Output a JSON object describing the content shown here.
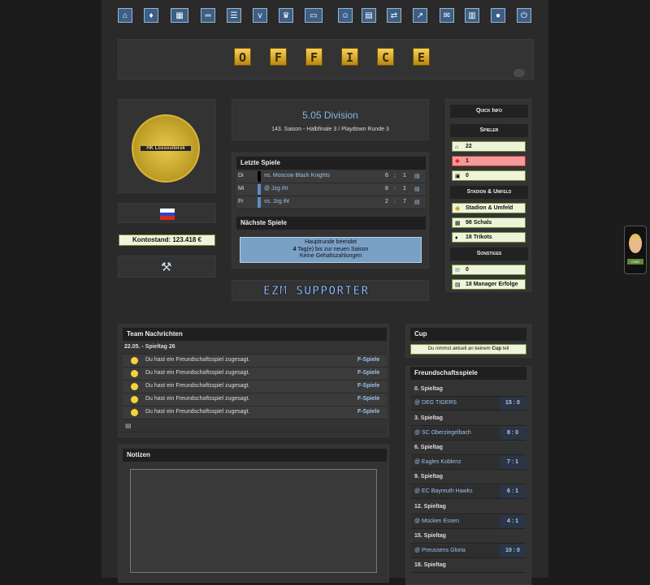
{
  "nav": {
    "icons": [
      "home-icon",
      "jersey-icon",
      "lineup-icon",
      "training-icon",
      "list-icon",
      "versus-icon",
      "trophy-icon",
      "tv-icon",
      "manager-icon",
      "calendar-icon",
      "transfer-icon",
      "stats-icon",
      "mail-icon",
      "table-icon",
      "chat-icon",
      "power-icon"
    ]
  },
  "banner": {
    "letters": [
      "O",
      "F",
      "F",
      "I",
      "C",
      "E"
    ]
  },
  "team": {
    "logo_text": "HK Lossosibirsk",
    "kontostand": "Kontostand: 123.418 €"
  },
  "division": {
    "name": "5.05 Division",
    "season": "143. Saison - Halbfinale 3 / Playdown Runde 3"
  },
  "last_games": {
    "header": "Letzte Spiele",
    "rows": [
      {
        "day": "Di",
        "opponent": "vs. Moscow Black Knights",
        "g1": "6",
        "sep": ":",
        "g2": "1"
      },
      {
        "day": "Mi",
        "opponent": "@ Jzg iht",
        "g1": "8",
        "sep": ":",
        "g2": "1"
      },
      {
        "day": "Fr",
        "opponent": "vs. Jzg iht",
        "g1": "2",
        "sep": ":",
        "g2": "7"
      }
    ]
  },
  "next_games": {
    "header": "Nächste Spiele",
    "line1": "Hauptrunde beendet",
    "line2_bold": "4",
    "line2_rest": " Tag(e) bis zur neuen Saison",
    "line3": "Keine Gehaltszahlungen"
  },
  "supporter": {
    "text": "EZM SUPPORTER"
  },
  "quick_info": {
    "title": "Quick Info",
    "spieler_header": "Spieler",
    "spieler": [
      {
        "icon": "house-icon",
        "value": "22"
      },
      {
        "icon": "medical-cross-icon",
        "value": "1"
      },
      {
        "icon": "id-card-icon",
        "value": "0"
      }
    ],
    "stadion_header": "Stadion & Umfeld",
    "stadion": [
      {
        "icon": "stadium-icon",
        "value": "Stadion & Umfeld"
      },
      {
        "icon": "scarf-icon",
        "value": "98 Schals"
      },
      {
        "icon": "jersey-icon",
        "value": "18 Trikots"
      }
    ],
    "sonstiges_header": "Sonstiges",
    "sonstiges": [
      {
        "icon": "envelope-icon",
        "value": "0"
      },
      {
        "icon": "achievement-icon",
        "value": "18 Manager Erfolge"
      }
    ]
  },
  "news": {
    "header": "Team Nachrichten",
    "date_row": "22.05. - Spieltag 26",
    "items": [
      {
        "text": "Du hast ein Freundschaftsspiel zugesagt.",
        "link": "F-Spiele"
      },
      {
        "text": "Du hast ein Freundschaftsspiel zugesagt.",
        "link": "F-Spiele"
      },
      {
        "text": "Du hast ein Freundschaftsspiel zugesagt.",
        "link": "F-Spiele"
      },
      {
        "text": "Du hast ein Freundschaftsspiel zugesagt.",
        "link": "F-Spiele"
      },
      {
        "text": "Du hast ein Freundschaftsspiel zugesagt.",
        "link": "F-Spiele"
      }
    ]
  },
  "notes": {
    "header": "Notizen"
  },
  "cup": {
    "header": "Cup",
    "text_pre": "Du nimmst aktuell an keinem ",
    "text_bold": "Cup",
    "text_post": " teil"
  },
  "friendlies": {
    "header": "Freundschaftsspiele",
    "items": [
      {
        "spieltag": "0. Spieltag",
        "opponent": "@ DEG TIGERS",
        "score": "15 : 0"
      },
      {
        "spieltag": "3. Spieltag",
        "opponent": "@ SC Oberziegelbach",
        "score": "8 : 0"
      },
      {
        "spieltag": "6. Spieltag",
        "opponent": "@ Eagles Koblenz",
        "score": "7 : 1"
      },
      {
        "spieltag": "9. Spieltag",
        "opponent": "@ EC Bayreuth Hawks",
        "score": "6 : 1"
      },
      {
        "spieltag": "12. Spieltag",
        "opponent": "@ Mücken Essen",
        "score": "4 : 1"
      },
      {
        "spieltag": "15. Spieltag",
        "opponent": "@ Preussens Gloria",
        "score": "10 : 0"
      },
      {
        "spieltag": "18. Spieltag"
      }
    ]
  },
  "side_widget": {
    "label": "CHAT"
  }
}
